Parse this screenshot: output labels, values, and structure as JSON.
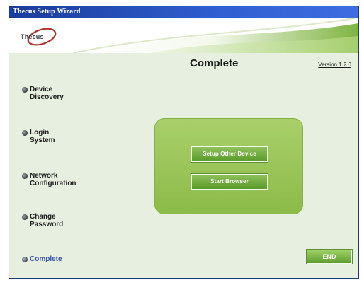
{
  "window": {
    "title": "Thecus Setup Wizard"
  },
  "banner": {
    "logo_text": "Thecus"
  },
  "sidebar": {
    "items": [
      {
        "label": "Device\nDiscovery",
        "active": false
      },
      {
        "label": "Login\nSystem",
        "active": false
      },
      {
        "label": "Network\nConfiguration",
        "active": false
      },
      {
        "label": "Change\nPassword",
        "active": false
      },
      {
        "label": "Complete",
        "active": true
      }
    ]
  },
  "main": {
    "title": "Complete",
    "version_link": "Version 1.2.0",
    "setup_other_device_label": "Setup Other Device",
    "start_browser_label": "Start Browser",
    "end_label": "END"
  },
  "colors": {
    "titlebar": "#1a3c9b",
    "background": "#e7efe0",
    "panel_green": "#9cc65a",
    "button_green": "#6aa83a",
    "active_step_text": "#3a55a8"
  }
}
